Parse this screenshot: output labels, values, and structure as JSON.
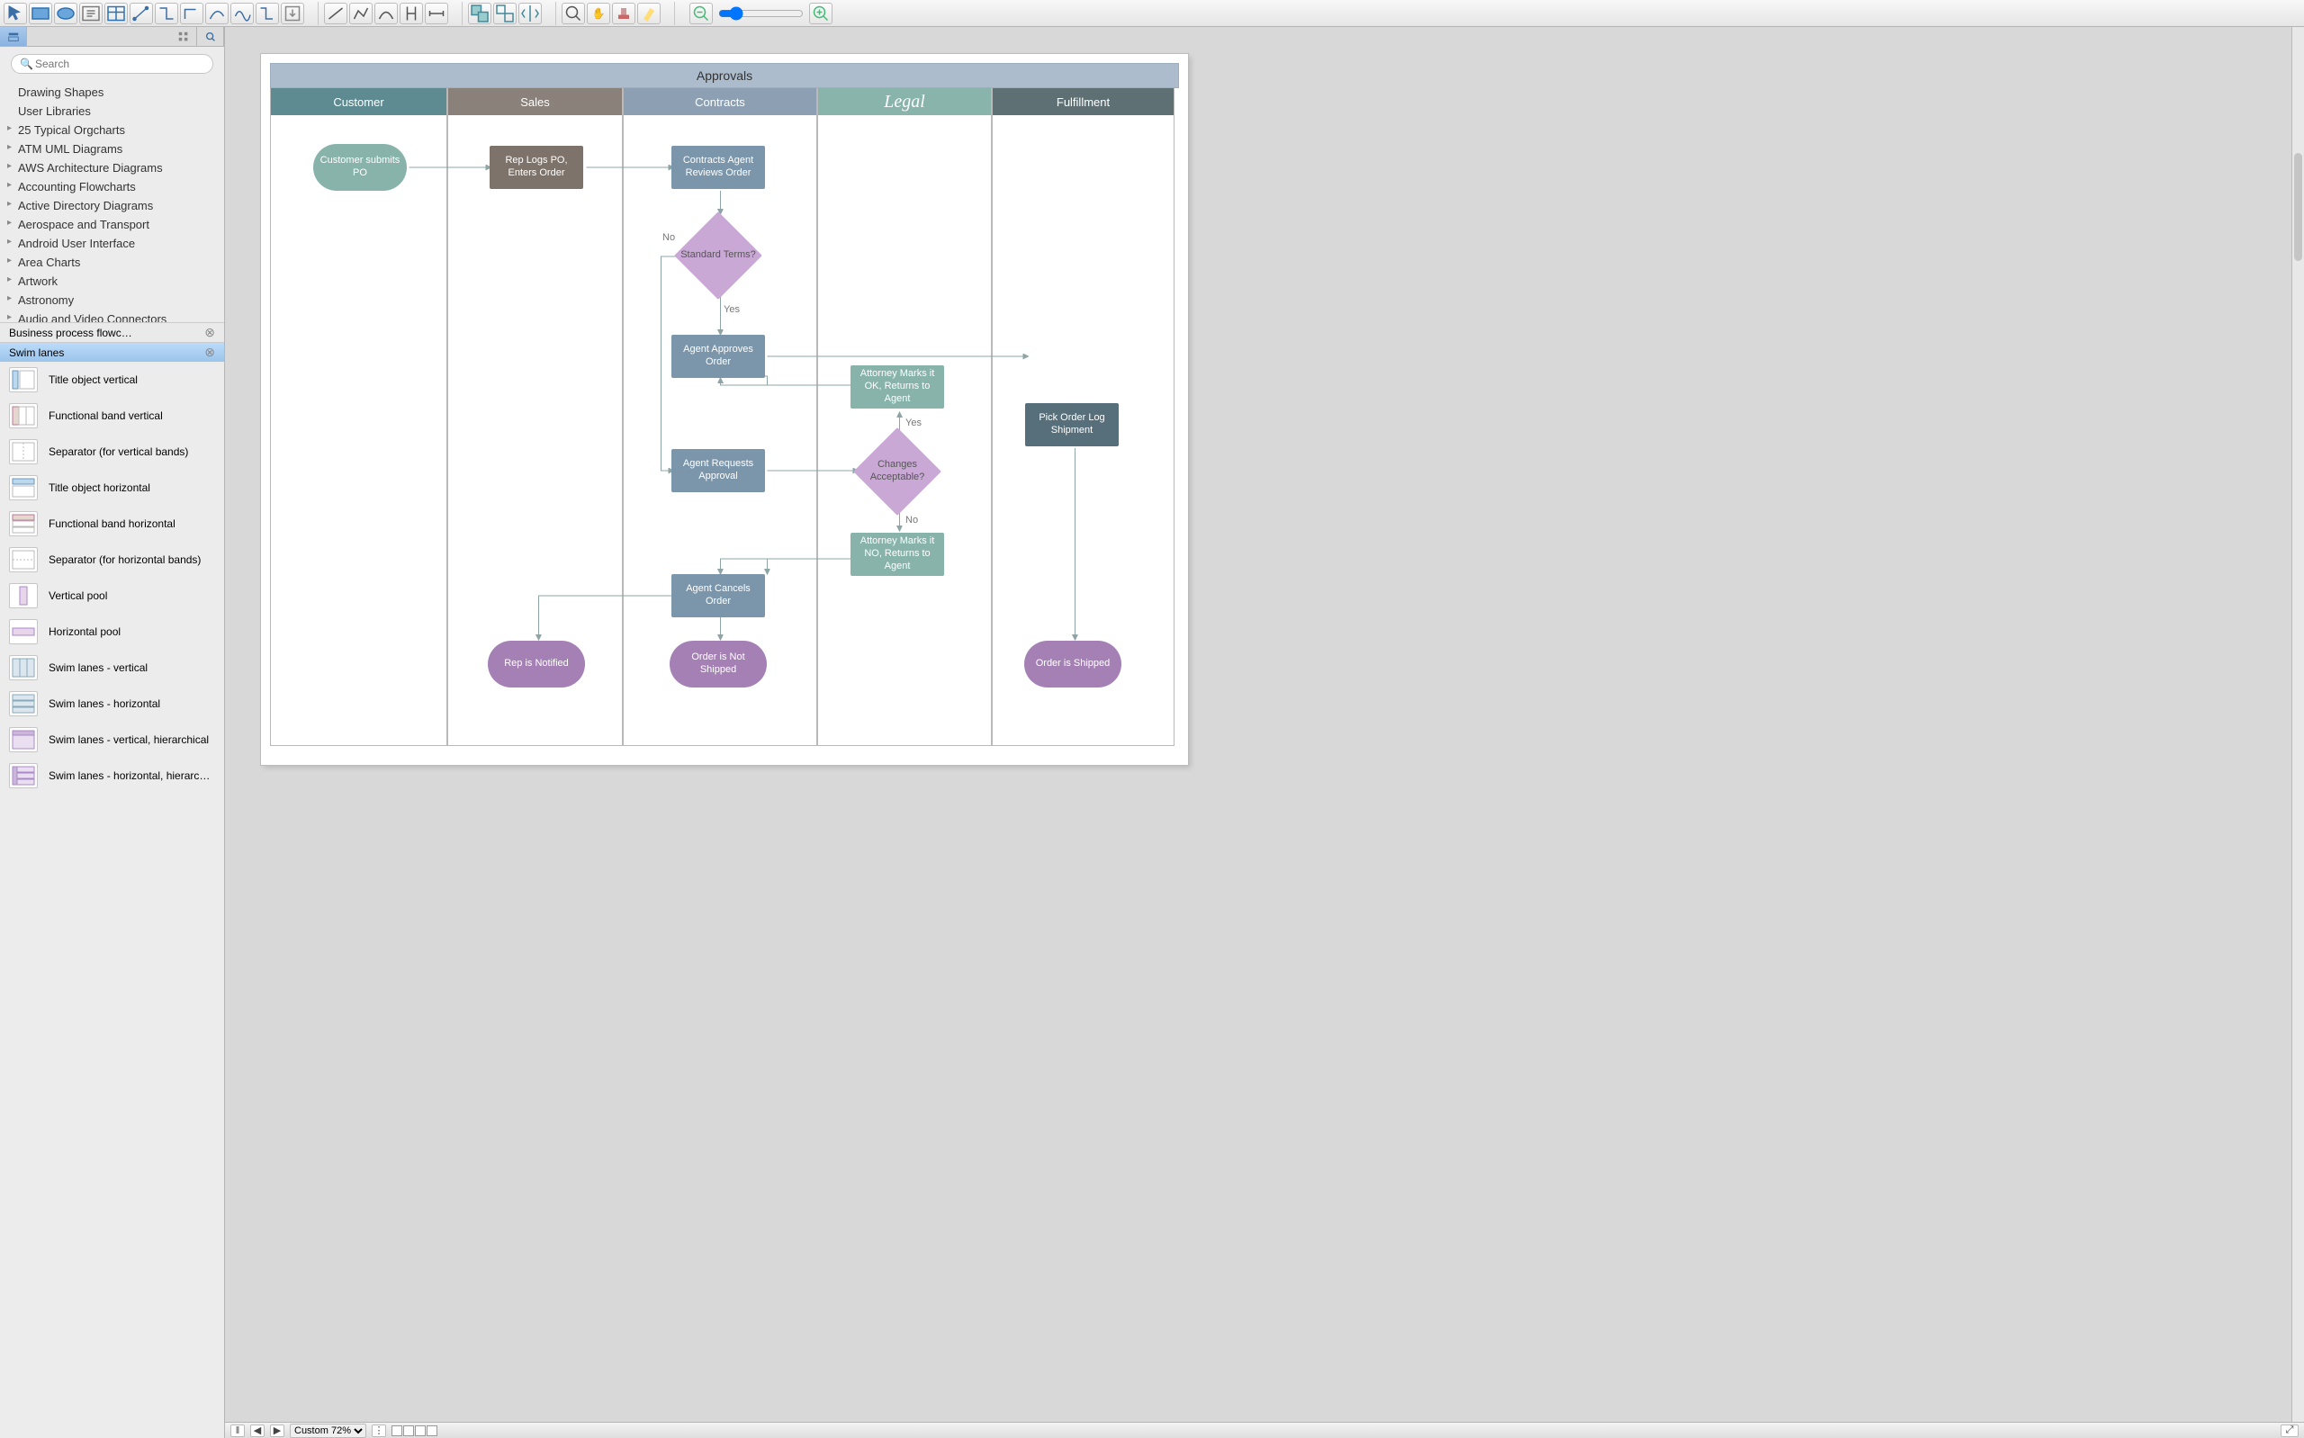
{
  "toolbar": {
    "groups": [
      [
        "select-tool",
        "rect-tool",
        "ellipse-tool",
        "text-tool",
        "table-tool",
        "connector-tool",
        "smart-connector",
        "right-angle",
        "curved",
        "spline",
        "orthogonal",
        "export"
      ],
      [
        "line-tool",
        "polyline",
        "curve",
        "bracket",
        "dimension"
      ],
      [
        "group",
        "ungroup",
        "flip"
      ],
      [
        "zoom-tool",
        "hand-tool",
        "stamp-tool",
        "highlighter"
      ]
    ],
    "zoom_out": "−",
    "zoom_in": "+"
  },
  "sidebar": {
    "search_placeholder": "Search",
    "tree": [
      {
        "label": "Drawing Shapes",
        "caret": false
      },
      {
        "label": "User Libraries",
        "caret": false
      },
      {
        "label": "25 Typical Orgcharts",
        "caret": true
      },
      {
        "label": "ATM UML Diagrams",
        "caret": true
      },
      {
        "label": "AWS Architecture Diagrams",
        "caret": true
      },
      {
        "label": "Accounting Flowcharts",
        "caret": true
      },
      {
        "label": "Active Directory Diagrams",
        "caret": true
      },
      {
        "label": "Aerospace and Transport",
        "caret": true
      },
      {
        "label": "Android User Interface",
        "caret": true
      },
      {
        "label": "Area Charts",
        "caret": true
      },
      {
        "label": "Artwork",
        "caret": true
      },
      {
        "label": "Astronomy",
        "caret": true
      },
      {
        "label": "Audio and Video Connectors",
        "caret": true
      }
    ],
    "lib_tabs": [
      {
        "label": "Business process flowc…",
        "active": false
      },
      {
        "label": "Swim lanes",
        "active": true
      }
    ],
    "shapes": [
      "Title object vertical",
      "Functional band vertical",
      "Separator (for vertical bands)",
      "Title object horizontal",
      "Functional band horizontal",
      "Separator (for horizontal bands)",
      "Vertical pool",
      "Horizontal pool",
      "Swim lanes - vertical",
      "Swim lanes - horizontal",
      "Swim lanes - vertical, hierarchical",
      "Swim lanes - horizontal, hierarc…"
    ]
  },
  "status": {
    "zoom_label": "Custom 72%"
  },
  "diagram": {
    "title": "Approvals",
    "lanes": [
      "Customer",
      "Sales",
      "Contracts",
      "Legal",
      "Fulfillment"
    ],
    "nodes": {
      "n_customer": "Customer submits PO",
      "n_rep": "Rep Logs PO, Enters Order",
      "n_review": "Contracts Agent Reviews Order",
      "n_std": "Standard Terms?",
      "n_approve": "Agent Approves Order",
      "n_request": "Agent Requests Approval",
      "n_ok": "Attorney Marks it OK, Returns to Agent",
      "n_chg": "Changes Acceptable?",
      "n_no": "Attorney Marks it NO, Returns to Agent",
      "n_cancel": "Agent Cancels Order",
      "n_pick": "Pick Order Log Shipment",
      "n_repnote": "Rep is Notified",
      "n_notship": "Order is Not Shipped",
      "n_shipped": "Order is Shipped"
    },
    "labels": {
      "no1": "No",
      "yes1": "Yes",
      "yes2": "Yes",
      "no2": "No"
    }
  }
}
